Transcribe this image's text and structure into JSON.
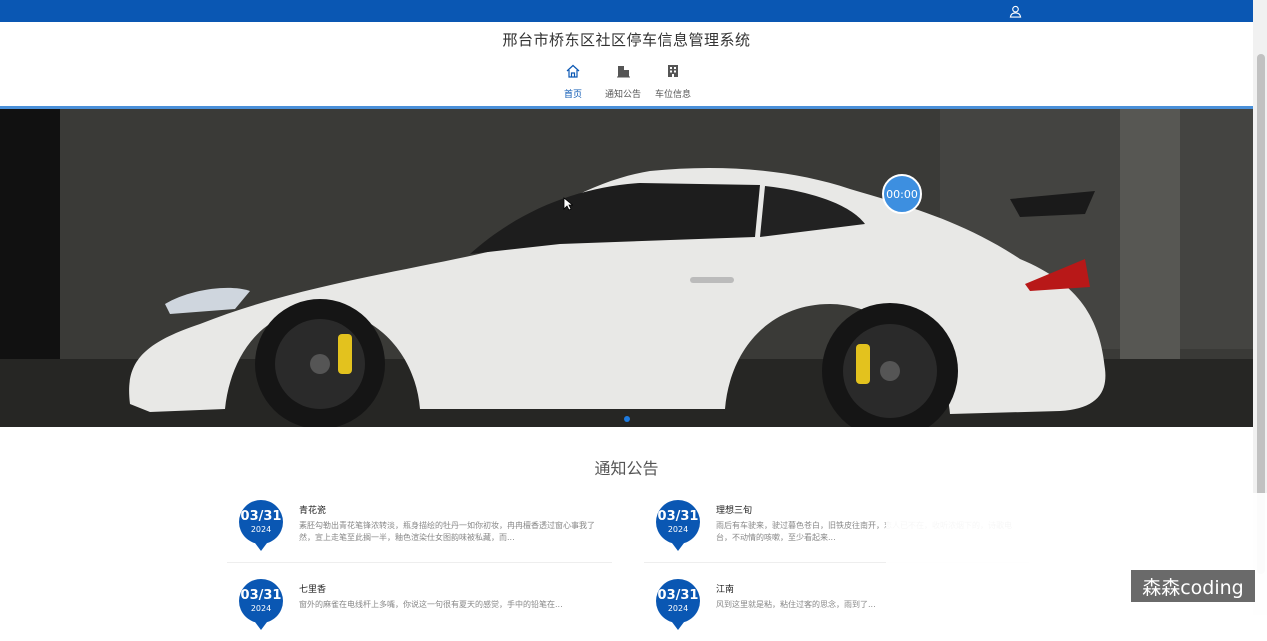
{
  "header": {
    "site_title": "邢台市桥东区社区停车信息管理系统"
  },
  "nav": {
    "items": [
      {
        "label": "首页",
        "icon": "home-icon",
        "active": true
      },
      {
        "label": "通知公告",
        "icon": "buildings-icon",
        "active": false
      },
      {
        "label": "车位信息",
        "icon": "building-icon",
        "active": false
      }
    ]
  },
  "banner": {
    "timer": "00:00",
    "active_slide": 1
  },
  "notices": {
    "title": "通知公告",
    "items": [
      {
        "date": "03/31",
        "year": "2024",
        "title": "青花瓷",
        "body": "素胚勾勒出青花笔锋浓转淡，瓶身描绘的牡丹一如你初妆，冉冉檀香透过窗心事我了然，宣上走笔至此搁一半，釉色渲染仕女图韵味被私藏，而..."
      },
      {
        "date": "03/31",
        "year": "2024",
        "title": "理想三旬",
        "body": "雨后有车驶来，驶过暮色苍白，旧铁皮往南开，恋人已不在，收听浓烟下的，诗歌电台，不动情的咳嗽，至少看起来..."
      },
      {
        "date": "03/31",
        "year": "2024",
        "title": "七里香",
        "body": "窗外的麻雀在电线杆上多嘴，你说这一句很有夏天的感觉，手中的铅笔在..."
      },
      {
        "date": "03/31",
        "year": "2024",
        "title": "江南",
        "body": "风到这里就是粘，粘住过客的思念，雨到了..."
      }
    ]
  },
  "watermark": "森森coding",
  "colors": {
    "primary": "#0a57b3",
    "accent_line": "#4a90d9",
    "timer": "#3d8fe0"
  }
}
